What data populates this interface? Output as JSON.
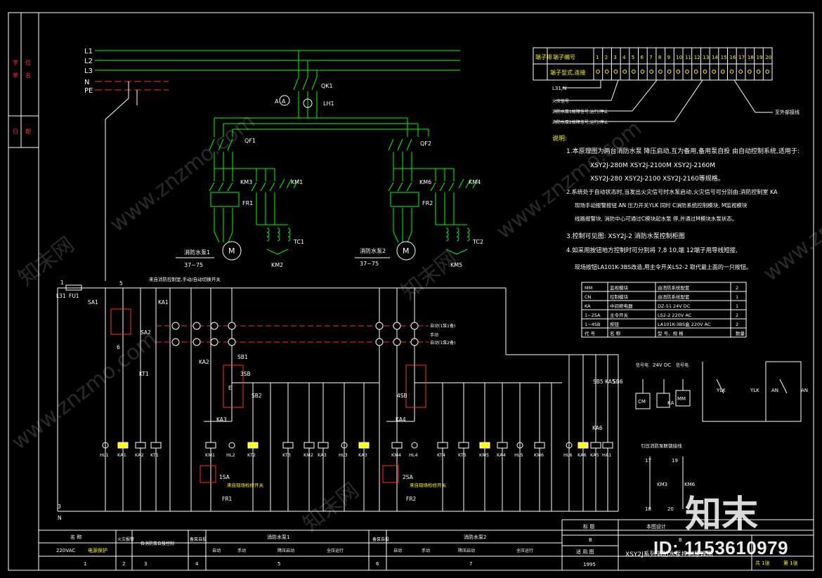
{
  "colors": {
    "green": "#00ff00",
    "yellow": "#ffff00",
    "red": "#ff3030",
    "cyan": "#00ffff",
    "white": "#ffffff",
    "magenta": "#ff00ff"
  },
  "left_strip": [
    "字",
    "单",
    "位",
    "名",
    "日",
    "期"
  ],
  "bus_labels": [
    "L1",
    "L2",
    "L3",
    "N",
    "PE"
  ],
  "main_circuit": {
    "qk1": "QK1",
    "lh1": "LH1",
    "ammeter": "A",
    "qf1": "QF1",
    "qf2": "QF2",
    "km3": "KM3",
    "km1": "KM1",
    "km6": "KM6",
    "km4": "KM4",
    "fr1": "FR1",
    "fr2": "FR2",
    "tc1": "TC1",
    "tc2": "TC2",
    "km2": "KM2",
    "km5": "KM5",
    "motor": "M",
    "pump1_name": "消防水泵1",
    "pump1_spec": "37~75",
    "pump2_name": "消防水泵2",
    "pump2_spec": "37~75"
  },
  "terminal_table": {
    "row1_title": "端子编号",
    "row2_title": "端子型式,连接",
    "row_head": "端子排",
    "numbers": [
      "1",
      "2",
      "3",
      "4",
      "5",
      "6",
      "7",
      "8",
      "9",
      "10",
      "11",
      "12",
      "13",
      "14",
      "15",
      "16",
      "17",
      "18",
      "19",
      "20"
    ],
    "wiring_labels": [
      "L31,N",
      "火灾信号",
      "消防水泵1故障信号,运行/停止",
      "消防水泵2故障信号,运行/停止"
    ],
    "external": "至外部接线"
  },
  "notes": {
    "heading": "说明:",
    "lines": [
      "1.本原理图为两台消防水泵 降压启动,互为备用,备用泵自投 由自动控制系统,适用于:",
      "XSY2J-280M XSY2J-2100M XSY2J-2160M",
      "XSY2J-280 XSY2J-2100 XSY2J-2160等规格。",
      "2.系统处于自动状态时,当发出火灾信号时水泵启动,火灾信号可分别由:消防控制室 KA",
      "现场手动报警按钮 AN 压力开关YLK 同时 C消防系统控制模块, M监视模块",
      "线路报警块, 消防中心可通过C模块起水泵 停,并通过M模块水泵状态。",
      "3.控制可见图: XSY2J-2 消防水泵控制柜图",
      "4.如采用按钮地方控制时可分别将 7,8 10,端 12端子用导线短接,",
      "现场按钮LA101K-3BS改造,用主令开关LS2-2 取代最上面的一只按钮。"
    ]
  },
  "materials": {
    "rows": [
      [
        "MM",
        "监视模块",
        "由消防系统配套",
        "2"
      ],
      [
        "CN",
        "控制模块",
        "由消防系统配套",
        "1"
      ],
      [
        "KA",
        "中间继电器",
        "DZ-51        24V DC",
        "1"
      ],
      [
        "1~2SA",
        "主令开关",
        "LS2-2        220V AC",
        "2"
      ],
      [
        "1~4SB",
        "按钮",
        "LA101K-3BS盒  220V AC",
        "2"
      ]
    ],
    "footer": [
      "代 号",
      "名 称",
      "型 号、规 格",
      "数量"
    ]
  },
  "control": {
    "l31": "L31",
    "fu1": "FU1",
    "sa1": "SA1",
    "n_label": "N",
    "node1": "1",
    "node3": "3",
    "node5": "5",
    "node6": "6",
    "sa2": "SA2",
    "ka1": "KA1",
    "kt1": "KT1",
    "note_sa": "来自消防控制室,手动/自动切换开关",
    "remote_auto": "自动(1泵1备)",
    "remote_manual": "手动",
    "remote_auto2": "自动(1泵2备)",
    "sb1": "SB1",
    "sb2": "SB2",
    "sb3": "3SB",
    "sb4": "4SB",
    "sb5": "SB5",
    "sb6": "SB6",
    "e": "E",
    "sa_1": "1SA",
    "sa_2": "2SA",
    "fr1": "FR1",
    "fr2": "FR2",
    "ka3": "KA3",
    "ka2": "KA2",
    "ka4": "KA4",
    "ka5": "KA5",
    "ka6": "KA6",
    "hl_labels": [
      "HL1",
      "KA1",
      "KA2",
      "KT1",
      "KM1",
      "HL2",
      "KT2",
      "KT3",
      "KM2",
      "KA3",
      "HL3",
      "KA3",
      "KM4",
      "HL4",
      "KT4",
      "KT5",
      "KM5",
      "KA4",
      "HL5",
      "KM6",
      "HL6",
      "KA6",
      "KA5",
      "HA1"
    ],
    "local_note": "来自现场检修开关",
    "cm": "CM",
    "ka": "KA",
    "mm": "MM",
    "dc24": "24V DC",
    "sig1": "信号电",
    "sig2": "信号电",
    "ylk": "YLK",
    "an": "AN",
    "press_note": "引压消防泵联锁接线",
    "n17": "17",
    "n18": "18",
    "n19": "19",
    "n20": "20",
    "km3": "KM3",
    "km6": "KM6"
  },
  "bottom_table": {
    "left": [
      {
        "name": "名 称",
        "no": "",
        "val": "220VAC",
        "desc": "电源保护"
      },
      {
        "name": "火灾报警",
        "no": "2"
      },
      {
        "name": "各消防泵自投控制",
        "no": "3"
      },
      {
        "name": "备泵自投",
        "no": "4"
      }
    ],
    "pump1": "消防水泵1",
    "pump2": "消防水泵2",
    "sub": [
      "自动",
      "手动",
      "降压启动",
      "全压运行"
    ],
    "sub2": [
      "自动",
      "手动",
      "降压启动",
      "全压运行"
    ],
    "standby": "备泵自投",
    "cols": [
      "1",
      "2",
      "3",
      "4",
      "5",
      "6",
      "7"
    ],
    "title_block": {
      "label1": "标 题",
      "b": "B",
      "label2": "适 用 图",
      "year": "1995",
      "label_sig": "本图设计",
      "b2": "B",
      "drawing_title": "XSY2J系列消防水泵控制原理图",
      "sheet": "共 1张",
      "page": "第 1张"
    }
  },
  "watermarks": [
    "www.znzmo.com",
    "知末网",
    "www.znzmo.com",
    "知末网",
    "www.znzmo.com",
    "知末网",
    "www.znzmo.com"
  ],
  "brand": {
    "logo": "知末",
    "id": "ID: 1153610979"
  }
}
